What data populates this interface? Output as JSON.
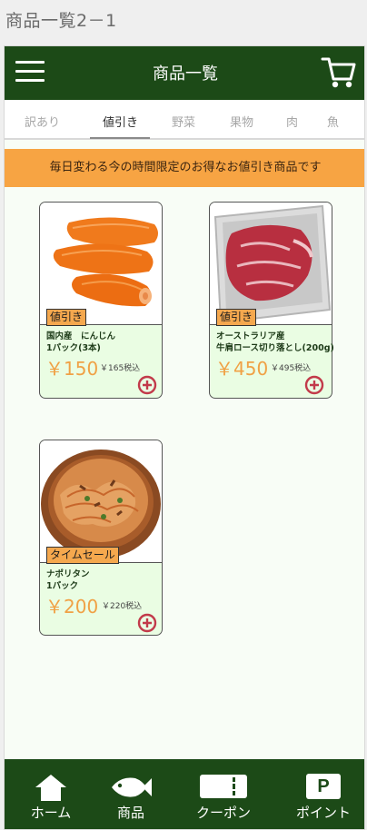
{
  "page_label": "商品一覧2－1",
  "header": {
    "title": "商品一覧"
  },
  "tabs": [
    {
      "label": "訳あり"
    },
    {
      "label": "値引き"
    },
    {
      "label": "野菜"
    },
    {
      "label": "果物"
    },
    {
      "label": "肉"
    },
    {
      "label": "魚"
    }
  ],
  "active_tab": "値引き",
  "banner": "毎日変わる今の時間限定のお得なお値引き商品です",
  "products": [
    {
      "tag": "値引き",
      "name": "国内産　にんじん\n1パック(3本)",
      "price": "￥150",
      "tax_price": "￥165税込",
      "image": "carrots"
    },
    {
      "tag": "値引き",
      "name": "オーストラリア産\n牛肩ロース切り落とし(200g)",
      "price": "￥450",
      "tax_price": "￥495税込",
      "image": "beef"
    },
    {
      "tag": "タイムセール",
      "name": "ナポリタン\n1パック",
      "price": "￥200",
      "tax_price": "￥220税込",
      "image": "napolitan"
    }
  ],
  "bottom_nav": [
    {
      "label": "ホーム",
      "icon": "home-icon"
    },
    {
      "label": "商品",
      "icon": "fish-icon"
    },
    {
      "label": "クーポン",
      "icon": "coupon-icon"
    },
    {
      "label": "ポイント",
      "icon": "point-icon",
      "glyph": "P"
    }
  ],
  "colors": {
    "header": "#1c4a17",
    "banner": "#f7a443",
    "card_bg": "#eafde3",
    "price": "#f0a145",
    "tag": "#f5a84e",
    "add_button": "#c23a4a"
  }
}
